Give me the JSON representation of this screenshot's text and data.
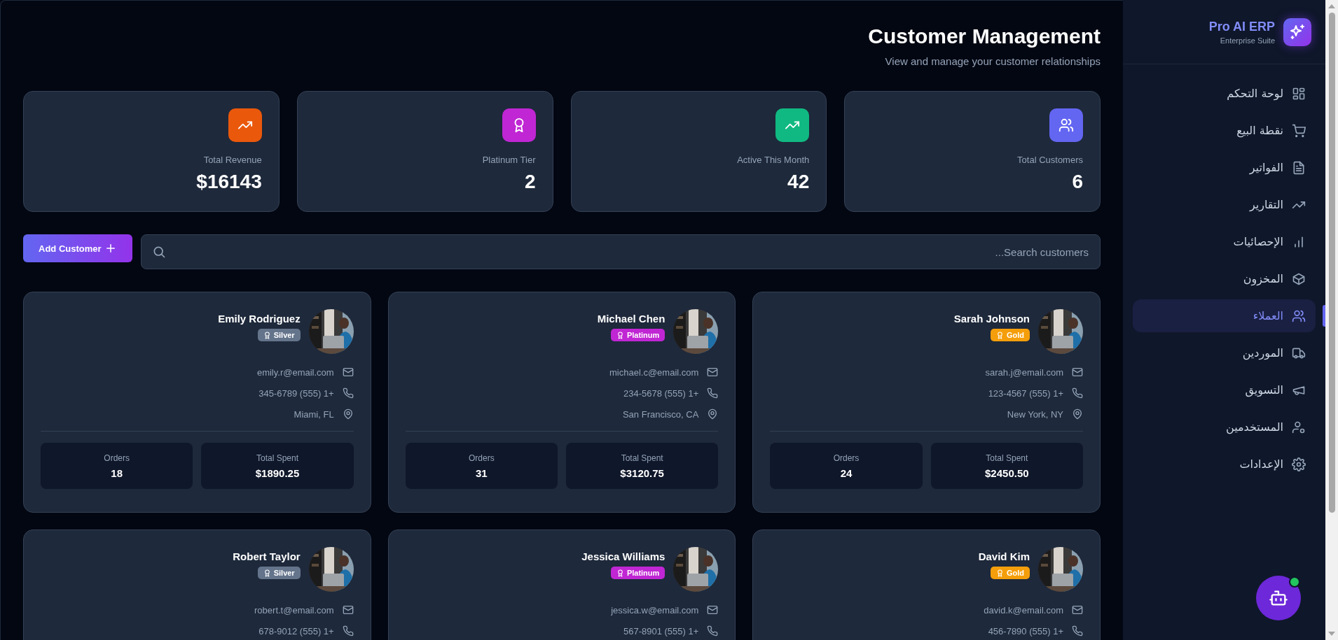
{
  "page": {
    "title": "Customer Management",
    "subtitle": "View and manage your customer relationships"
  },
  "stats": [
    {
      "kind": "revenue",
      "label": "Total Revenue",
      "value": "$16143",
      "color": "#ea580c"
    },
    {
      "kind": "tier",
      "label": "Platinum Tier",
      "value": "2",
      "color": "#c026d3"
    },
    {
      "kind": "activity",
      "label": "Active This Month",
      "value": "42",
      "color": "#10b981"
    },
    {
      "kind": "customers",
      "label": "Total Customers",
      "value": "6",
      "color": "#6366f1"
    }
  ],
  "toolbar": {
    "add_button": "Add Customer",
    "search": {
      "placeholder": "...Search customers"
    }
  },
  "customers": [
    {
      "name": "Emily Rodriguez",
      "tier": "Silver",
      "color": "#64748b",
      "contacts": [
        {
          "kind": "email",
          "text": "emily.r@email.com"
        },
        {
          "kind": "phone",
          "text": "345-6789 (555) 1+"
        },
        {
          "kind": "location",
          "text": "Miami, FL"
        }
      ],
      "orders_label": "Orders",
      "orders": "18",
      "spent_label": "Total Spent",
      "spent": "$1890.25"
    },
    {
      "name": "Michael Chen",
      "tier": "Platinum",
      "color": "#c026d3",
      "contacts": [
        {
          "kind": "email",
          "text": "michael.c@email.com"
        },
        {
          "kind": "phone",
          "text": "234-5678 (555) 1+"
        },
        {
          "kind": "location",
          "text": "San Francisco, CA"
        }
      ],
      "orders_label": "Orders",
      "orders": "31",
      "spent_label": "Total Spent",
      "spent": "$3120.75"
    },
    {
      "name": "Sarah Johnson",
      "tier": "Gold",
      "color": "#f59e0b",
      "contacts": [
        {
          "kind": "email",
          "text": "sarah.j@email.com"
        },
        {
          "kind": "phone",
          "text": "123-4567 (555) 1+"
        },
        {
          "kind": "location",
          "text": "New York, NY"
        }
      ],
      "orders_label": "Orders",
      "orders": "24",
      "spent_label": "Total Spent",
      "spent": "$2450.50"
    },
    {
      "name": "Robert Taylor",
      "tier": "Silver",
      "color": "#64748b",
      "contacts": [
        {
          "kind": "email",
          "text": "robert.t@email.com"
        },
        {
          "kind": "phone",
          "text": "678-9012 (555) 1+"
        }
      ]
    },
    {
      "name": "Jessica Williams",
      "tier": "Platinum",
      "color": "#c026d3",
      "contacts": [
        {
          "kind": "email",
          "text": "jessica.w@email.com"
        },
        {
          "kind": "phone",
          "text": "567-8901 (555) 1+"
        }
      ]
    },
    {
      "name": "David Kim",
      "tier": "Gold",
      "color": "#f59e0b",
      "contacts": [
        {
          "kind": "email",
          "text": "david.k@email.com"
        },
        {
          "kind": "phone",
          "text": "456-7890 (555) 1+"
        }
      ]
    }
  ],
  "sidebar": {
    "brand": "Pro AI ERP",
    "tagline": "Enterprise Suite",
    "items": [
      {
        "kind": "dashboard",
        "label": "لوحة التحكم",
        "selected": false
      },
      {
        "kind": "pos",
        "label": "نقطة البيع",
        "selected": false
      },
      {
        "kind": "invoices",
        "label": "الفواتير",
        "selected": false
      },
      {
        "kind": "reports",
        "label": "التقارير",
        "selected": false
      },
      {
        "kind": "stats",
        "label": "الإحصائيات",
        "selected": false
      },
      {
        "kind": "inventory",
        "label": "المخزون",
        "selected": false
      },
      {
        "kind": "customers",
        "label": "العملاء",
        "selected": true
      },
      {
        "kind": "suppliers",
        "label": "الموردين",
        "selected": false
      },
      {
        "kind": "marketing",
        "label": "التسويق",
        "selected": false
      },
      {
        "kind": "users",
        "label": "المستخدمين",
        "selected": false
      },
      {
        "kind": "settings",
        "label": "الإعدادات",
        "selected": false
      }
    ]
  },
  "assistant": {
    "online": true
  }
}
